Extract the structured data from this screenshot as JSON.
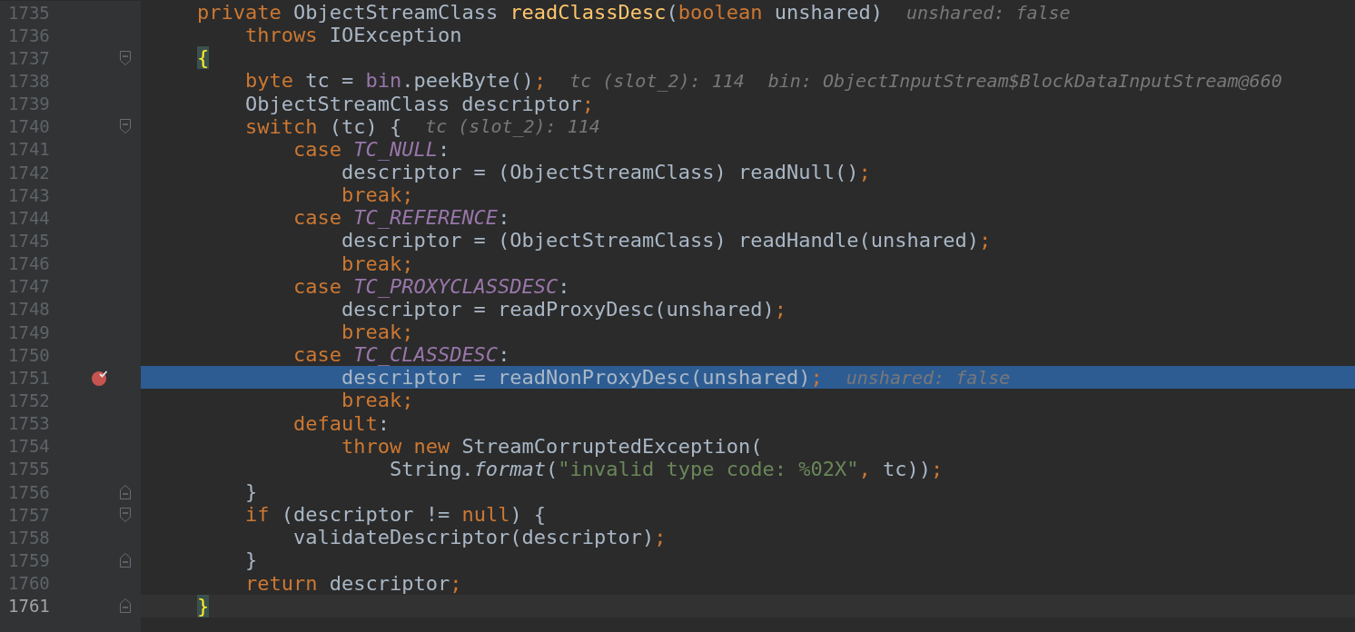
{
  "editor": {
    "lines": [
      {
        "number": "1735",
        "selected": false,
        "current": false,
        "breakpoint": false,
        "code": [
          {
            "kind": "keyword",
            "text": "    private "
          },
          {
            "kind": "plain",
            "text": "ObjectStreamClass "
          },
          {
            "kind": "method",
            "text": "readClassDesc"
          },
          {
            "kind": "plain",
            "text": "("
          },
          {
            "kind": "keyword",
            "text": "boolean "
          },
          {
            "kind": "plain",
            "text": "unshared)"
          }
        ],
        "hints": [
          "unshared: false"
        ]
      },
      {
        "number": "1736",
        "selected": false,
        "current": false,
        "breakpoint": false,
        "code": [
          {
            "kind": "keyword",
            "text": "        throws "
          },
          {
            "kind": "plain",
            "text": "IOException"
          }
        ]
      },
      {
        "number": "1737",
        "selected": false,
        "current": false,
        "breakpoint": false,
        "fold_marker": {
          "kind": "start"
        },
        "code": [
          {
            "kind": "brace",
            "text": "    {"
          }
        ]
      },
      {
        "number": "1738",
        "selected": false,
        "current": false,
        "breakpoint": false,
        "code": [
          {
            "kind": "keyword",
            "text": "        byte "
          },
          {
            "kind": "plain",
            "text": "tc = "
          },
          {
            "kind": "field",
            "text": "bin"
          },
          {
            "kind": "plain",
            "text": ".peekByte()"
          },
          {
            "kind": "keyword",
            "text": ";"
          }
        ],
        "hints": [
          "tc (slot_2): 114",
          "bin: ObjectInputStream$BlockDataInputStream@660"
        ]
      },
      {
        "number": "1739",
        "selected": false,
        "current": false,
        "breakpoint": false,
        "code": [
          {
            "kind": "plain",
            "text": "        ObjectStreamClass descriptor"
          },
          {
            "kind": "keyword",
            "text": ";"
          }
        ]
      },
      {
        "number": "1740",
        "selected": false,
        "current": false,
        "breakpoint": false,
        "fold_marker": {
          "kind": "start"
        },
        "code": [
          {
            "kind": "keyword",
            "text": "        switch "
          },
          {
            "kind": "plain",
            "text": "(tc) {"
          }
        ],
        "hints": [
          "tc (slot_2): 114"
        ]
      },
      {
        "number": "1741",
        "selected": false,
        "current": false,
        "breakpoint": false,
        "code": [
          {
            "kind": "keyword",
            "text": "            case "
          },
          {
            "kind": "constant",
            "text": "TC_NULL"
          },
          {
            "kind": "plain",
            "text": ":"
          }
        ]
      },
      {
        "number": "1742",
        "selected": false,
        "current": false,
        "breakpoint": false,
        "code": [
          {
            "kind": "plain",
            "text": "                descriptor = (ObjectStreamClass) readNull()"
          },
          {
            "kind": "keyword",
            "text": ";"
          }
        ]
      },
      {
        "number": "1743",
        "selected": false,
        "current": false,
        "breakpoint": false,
        "code": [
          {
            "kind": "keyword",
            "text": "                break;"
          }
        ]
      },
      {
        "number": "1744",
        "selected": false,
        "current": false,
        "breakpoint": false,
        "code": [
          {
            "kind": "keyword",
            "text": "            case "
          },
          {
            "kind": "constant",
            "text": "TC_REFERENCE"
          },
          {
            "kind": "plain",
            "text": ":"
          }
        ]
      },
      {
        "number": "1745",
        "selected": false,
        "current": false,
        "breakpoint": false,
        "code": [
          {
            "kind": "plain",
            "text": "                descriptor = (ObjectStreamClass) readHandle(unshared)"
          },
          {
            "kind": "keyword",
            "text": ";"
          }
        ]
      },
      {
        "number": "1746",
        "selected": false,
        "current": false,
        "breakpoint": false,
        "code": [
          {
            "kind": "keyword",
            "text": "                break;"
          }
        ]
      },
      {
        "number": "1747",
        "selected": false,
        "current": false,
        "breakpoint": false,
        "code": [
          {
            "kind": "keyword",
            "text": "            case "
          },
          {
            "kind": "constant",
            "text": "TC_PROXYCLASSDESC"
          },
          {
            "kind": "plain",
            "text": ":"
          }
        ]
      },
      {
        "number": "1748",
        "selected": false,
        "current": false,
        "breakpoint": false,
        "code": [
          {
            "kind": "plain",
            "text": "                descriptor = readProxyDesc(unshared)"
          },
          {
            "kind": "keyword",
            "text": ";"
          }
        ]
      },
      {
        "number": "1749",
        "selected": false,
        "current": false,
        "breakpoint": false,
        "code": [
          {
            "kind": "keyword",
            "text": "                break;"
          }
        ]
      },
      {
        "number": "1750",
        "selected": false,
        "current": false,
        "breakpoint": false,
        "code": [
          {
            "kind": "keyword",
            "text": "            case "
          },
          {
            "kind": "constant",
            "text": "TC_CLASSDESC"
          },
          {
            "kind": "plain",
            "text": ":"
          }
        ]
      },
      {
        "number": "1751",
        "selected": true,
        "current": false,
        "breakpoint": true,
        "code": [
          {
            "kind": "plain",
            "text": "                descriptor = readNonProxyDesc(unshared)"
          },
          {
            "kind": "keyword",
            "text": ";"
          }
        ],
        "hints": [
          "unshared: false"
        ]
      },
      {
        "number": "1752",
        "selected": false,
        "current": false,
        "breakpoint": false,
        "code": [
          {
            "kind": "keyword",
            "text": "                break;"
          }
        ]
      },
      {
        "number": "1753",
        "selected": false,
        "current": false,
        "breakpoint": false,
        "code": [
          {
            "kind": "keyword",
            "text": "            default"
          },
          {
            "kind": "plain",
            "text": ":"
          }
        ]
      },
      {
        "number": "1754",
        "selected": false,
        "current": false,
        "breakpoint": false,
        "code": [
          {
            "kind": "keyword",
            "text": "                throw new "
          },
          {
            "kind": "plain",
            "text": "StreamCorruptedException("
          }
        ]
      },
      {
        "number": "1755",
        "selected": false,
        "current": false,
        "breakpoint": false,
        "code": [
          {
            "kind": "plain",
            "text": "                    String."
          },
          {
            "kind": "static",
            "text": "format"
          },
          {
            "kind": "plain",
            "text": "("
          },
          {
            "kind": "string",
            "text": "\"invalid type code: %02X\""
          },
          {
            "kind": "keyword",
            "text": ", "
          },
          {
            "kind": "plain",
            "text": "tc))"
          },
          {
            "kind": "keyword",
            "text": ";"
          }
        ]
      },
      {
        "number": "1756",
        "selected": false,
        "current": false,
        "breakpoint": false,
        "fold_marker": {
          "kind": "end"
        },
        "code": [
          {
            "kind": "plain",
            "text": "        }"
          }
        ]
      },
      {
        "number": "1757",
        "selected": false,
        "current": false,
        "breakpoint": false,
        "fold_marker": {
          "kind": "start"
        },
        "code": [
          {
            "kind": "keyword",
            "text": "        if "
          },
          {
            "kind": "plain",
            "text": "(descriptor != "
          },
          {
            "kind": "keyword",
            "text": "null"
          },
          {
            "kind": "plain",
            "text": ") {"
          }
        ]
      },
      {
        "number": "1758",
        "selected": false,
        "current": false,
        "breakpoint": false,
        "code": [
          {
            "kind": "plain",
            "text": "            validateDescriptor(descriptor)"
          },
          {
            "kind": "keyword",
            "text": ";"
          }
        ]
      },
      {
        "number": "1759",
        "selected": false,
        "current": false,
        "breakpoint": false,
        "fold_marker": {
          "kind": "end"
        },
        "code": [
          {
            "kind": "plain",
            "text": "        }"
          }
        ]
      },
      {
        "number": "1760",
        "selected": false,
        "current": false,
        "breakpoint": false,
        "code": [
          {
            "kind": "keyword",
            "text": "        return "
          },
          {
            "kind": "plain",
            "text": "descriptor"
          },
          {
            "kind": "keyword",
            "text": ";"
          }
        ]
      },
      {
        "number": "1761",
        "selected": false,
        "current": true,
        "breakpoint": false,
        "fold_marker": {
          "kind": "end"
        },
        "code": [
          {
            "kind": "brace",
            "text": "    }"
          }
        ]
      }
    ]
  }
}
